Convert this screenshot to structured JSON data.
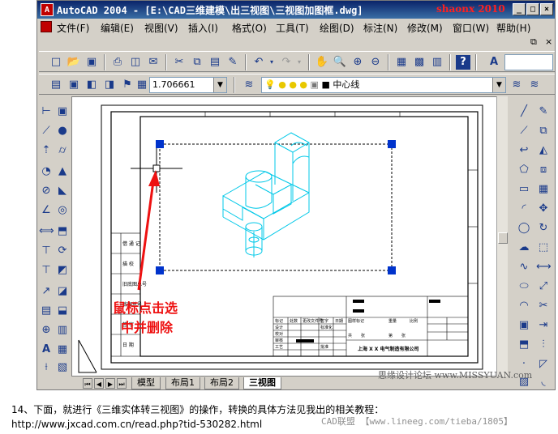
{
  "window": {
    "title": "AutoCAD 2004 - [E:\\CAD三维建模\\出三视图\\三视图加图框.dwg]",
    "watermark": "shaonx 2010"
  },
  "menu": [
    "文件(F)",
    "编辑(E)",
    "视图(V)",
    "插入(I)",
    "格式(O)",
    "工具(T)",
    "绘图(D)",
    "标注(N)",
    "修改(M)",
    "窗口(W)",
    "帮助(H)"
  ],
  "toolbar": {
    "scale_value": "1.706661",
    "layer_name": "中心线"
  },
  "drawing": {
    "annotation_line1": "鼠标点击选",
    "annotation_line2": "中并删除",
    "company": "上海 X X 电气制造有限公司",
    "left_block_labels": [
      "借 通 记",
      "描 校",
      "旧底图总号",
      "底图总号",
      "签 字",
      "日 期"
    ],
    "title_block_labels": [
      "标记",
      "处数",
      "更改文件号",
      "签字",
      "日期",
      "设计",
      "标准化",
      "校对",
      "审核",
      "工艺",
      "批准",
      "图样标记",
      "重量",
      "比例",
      "共",
      "张",
      "第",
      "张"
    ]
  },
  "tabs": [
    "模型",
    "布局1",
    "布局2",
    "三视图"
  ],
  "active_tab": "三视图",
  "tab_watermark": "思缘设计论坛 www.MISSYUAN.com",
  "caption": {
    "line1": "14、下面，就进行《三维实体转三视图》的操作，转换的具体方法见我出的相关教程：",
    "line2": "http://www.jxcad.com.cn/read.php?tid-530282.html",
    "credit": "CAD联盟 【www.lineeg.com/tieba/1805】"
  },
  "colors": {
    "model_lines": "#00c8e8",
    "handle": "#0033cc",
    "arrow": "#ee1111",
    "title_bar": "#0a246a"
  }
}
